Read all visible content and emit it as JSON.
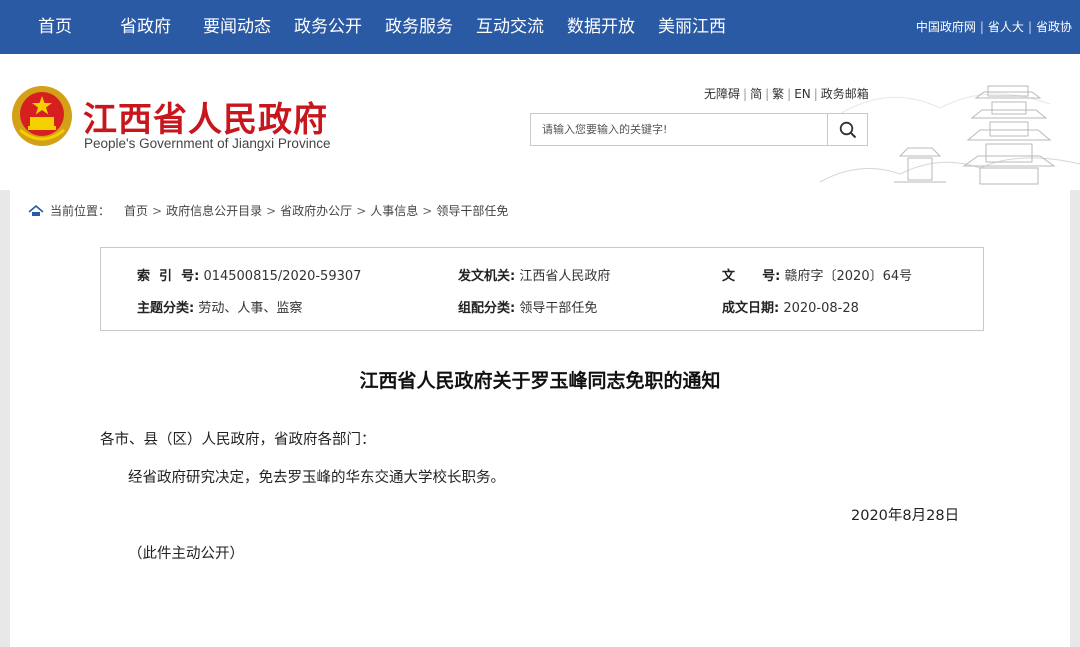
{
  "nav": {
    "items": [
      "首页",
      "省政府",
      "要闻动态",
      "政务公开",
      "政务服务",
      "互动交流",
      "数据开放",
      "美丽江西"
    ],
    "right_links": [
      "中国政府网",
      "省人大",
      "省政协"
    ]
  },
  "header": {
    "title": "江西省人民政府",
    "subtitle": "People's Government of Jiangxi Province",
    "util_links": [
      "无障碍",
      "简",
      "繁",
      "EN",
      "政务邮箱"
    ],
    "search_placeholder": "请输入您要输入的关键字!"
  },
  "breadcrumb": {
    "lead": "当前位置：",
    "items": [
      "首页",
      "政府信息公开目录",
      "省政府办公厅",
      "人事信息",
      "领导干部任免"
    ]
  },
  "meta": {
    "index_label": "索  引  号:",
    "index_value": "014500815/2020-59307",
    "issuer_label": "发文机关:",
    "issuer_value": "江西省人民政府",
    "docno_label": "文      号:",
    "docno_value": "赣府字〔2020〕64号",
    "topic_label": "主题分类:",
    "topic_value": "劳动、人事、监察",
    "category_label": "组配分类:",
    "category_value": "领导干部任免",
    "date_label": "成文日期:",
    "date_value": "2020-08-28"
  },
  "document": {
    "title": "江西省人民政府关于罗玉峰同志免职的通知",
    "salutation": "各市、县（区）人民政府，省政府各部门：",
    "body": "经省政府研究决定，免去罗玉峰的华东交通大学校长职务。",
    "date": "2020年8月28日",
    "note": "（此件主动公开）"
  },
  "colors": {
    "nav_bg": "#2b5aa5",
    "title_red": "#c8161d"
  }
}
